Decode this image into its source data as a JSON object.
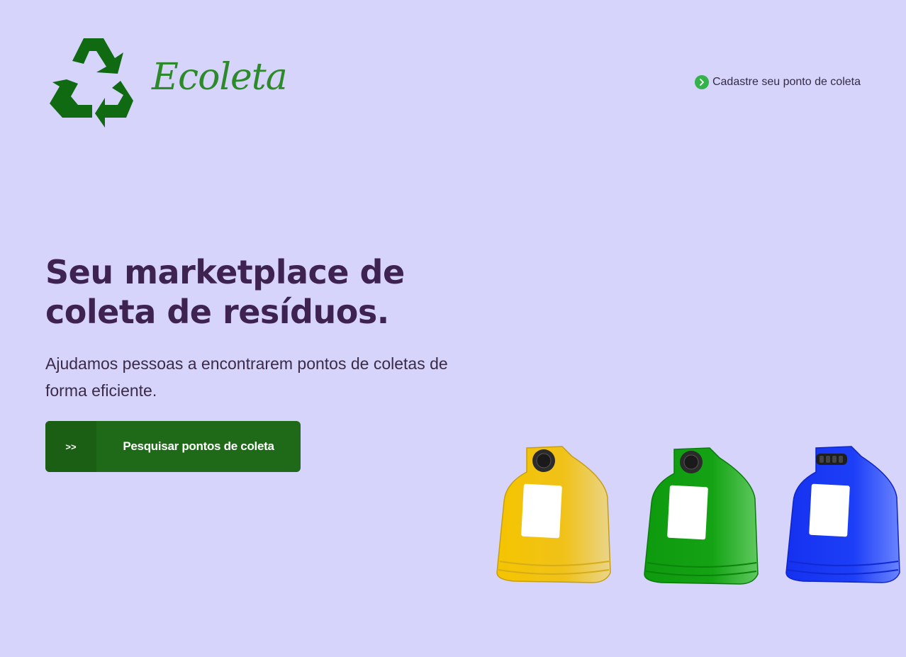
{
  "header": {
    "logo_text": "Ecoleta",
    "nav_link_label": "Cadastre seu ponto de coleta"
  },
  "hero": {
    "title_line1": "Seu marketplace de",
    "title_line2": "coleta de resíduos.",
    "description": "Ajudamos pessoas a encontrarem pontos de coletas de forma eficiente.",
    "search_button_icon": ">>",
    "search_button_label": "Pesquisar pontos de coleta"
  },
  "colors": {
    "background": "#d6d4fb",
    "brand_green": "#2d8a2a",
    "logo_icon_green": "#0f6a12",
    "button_green": "#1f6a18",
    "title": "#3e2350",
    "bin_yellow": "#f2c40a",
    "bin_green": "#12a012",
    "bin_blue": "#1b3cf5"
  },
  "icons": {
    "logo": "recycle-icon",
    "nav": "chevron-right-icon",
    "illustration": "recycling-bins-illustration"
  }
}
